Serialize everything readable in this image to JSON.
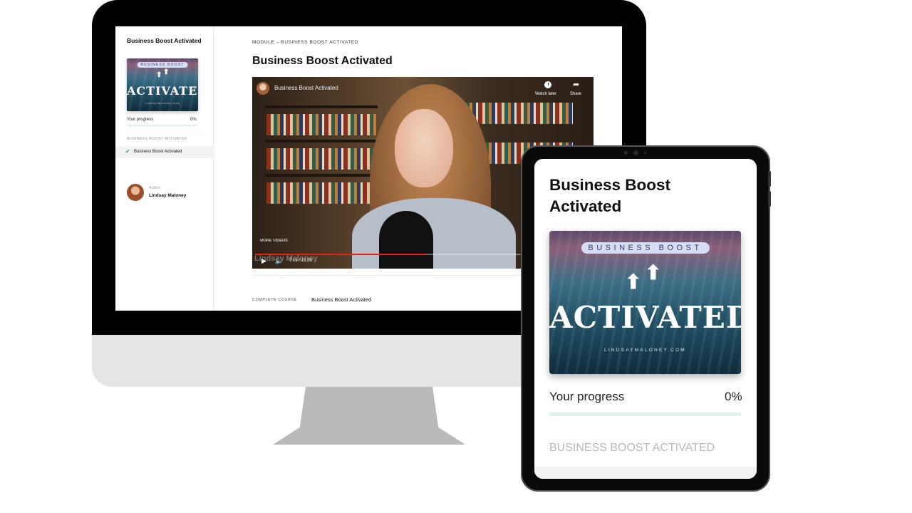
{
  "desktop": {
    "sidebar": {
      "course_title": "Business Boost Activated",
      "thumbnail": {
        "pill_text": "BUSINESS BOOST",
        "big_text": "ACTIVATED",
        "url_text": "LINDSAYMALONEY.COM"
      },
      "progress_label": "Your progress",
      "progress_value": "0%",
      "progress_fraction": 0,
      "section_label": "BUSINESS BOOST ACTIVATED",
      "lessons": [
        {
          "label": "Business Boost Activated",
          "completed": true,
          "icon": "check-icon"
        }
      ],
      "author_label": "Author",
      "author_name": "Lindsay Maloney"
    },
    "main": {
      "breadcrumb": "MODULE – BUSINESS BOOST ACTIVATED",
      "title": "Business Boost Activated",
      "video": {
        "title": "Business Boost Activated",
        "watch_later_label": "Watch later",
        "share_label": "Share",
        "more_videos_label": "MORE VIDEOS",
        "time": "7:15 / 13:29",
        "watermark": "Lindsay Maloney",
        "played_fraction": 0.51,
        "icons": [
          "clock-icon",
          "share-icon",
          "play-icon",
          "volume-icon"
        ]
      },
      "complete_course_label": "COMPLETE COURSE",
      "complete_course_value": "Business Boost Activated"
    }
  },
  "tablet": {
    "title": "Business Boost Activated",
    "thumbnail": {
      "pill_text": "BUSINESS BOOST",
      "big_text": "ACTIVATED",
      "url_text": "LINDSAYMALONEY.COM"
    },
    "progress_label": "Your progress",
    "progress_value": "0%",
    "progress_fraction": 0,
    "section_label": "BUSINESS BOOST ACTIVATED"
  },
  "colors": {
    "accent": "#3fa79b",
    "progress_track": "#dff2ef",
    "youtube_red": "#e62117"
  }
}
